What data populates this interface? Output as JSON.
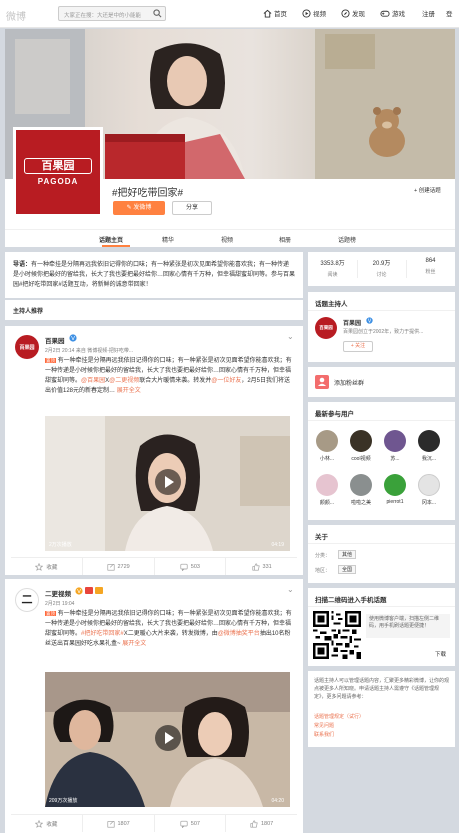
{
  "topbar": {
    "logo": "微博",
    "search_placeholder": "大家正在搜：大还是中的小能能",
    "nav": [
      "首页",
      "视频",
      "发现",
      "游戏"
    ],
    "register": "注册",
    "login": "登"
  },
  "topic": {
    "title": "#把好吃带回家#",
    "brand_cn": "百果园",
    "brand_en": "PAGODA",
    "create_topic": "+ 创建话题",
    "post_button": "发微博",
    "share_button": "分享",
    "tabs": [
      "话题主页",
      "精华",
      "视频",
      "相册",
      "话题榜"
    ]
  },
  "stats": {
    "values": [
      "3353.8万",
      "20.9万",
      "864"
    ],
    "labels": [
      "阅读",
      "讨论",
      "粉丝"
    ]
  },
  "guide": {
    "label": "导语：",
    "text": "有一种牵挂是分隔再远我依旧记得你的口味；有一种紧张是初次见面希望你能喜欢我；有一种传递是小时候你把最好的留给我，长大了我也要把最好给你…回家心情有千万种，但幸福甜蜜却同等。参与百果园#把好吃带回家#话题互动，将新鲜的诚意带回家！"
  },
  "host_recommend": {
    "title": "主持人推荐"
  },
  "posts": [
    {
      "user": "百果园",
      "meta": "2月2日 20:14 来自 微博视频-把好吃带...",
      "text_1": "有一种牵挂是分隔再远我依旧记得你的口味；有一种紧张是初次见面希望你能喜欢我；有一种传递是小时候你把最好的留给我，长大了我也要把最好给你…回家心情有千万种，但幸福甜蜜却同等。",
      "mention_1": "@百果园",
      "text_2": "X",
      "mention_2": "@二更视频",
      "text_3": "联合大片暖情来袭。转发并",
      "mention_3": "@一位好友",
      "text_4": "，2月5日我们将送出价值128元的新春定制…",
      "expand": "展开全文",
      "video_views": "2万次播放",
      "video_time": "04:19",
      "actions": [
        "收藏",
        "2729",
        "503",
        "331"
      ]
    },
    {
      "user": "二更视频",
      "meta": "2月2日 19:04",
      "text_1": "有一种牵挂是分隔再远我依旧记得你的口味；有一种紧张是初次见面希望你能喜欢我；有一种传递是小时候你把最好的留给我，长大了我也要把最好给你…回家心情有千万种，但幸福甜蜜却同等。",
      "topic_tag": "#把好吃带回家#",
      "text_2": "X二更暖心大片来袭，转发微博，由",
      "mention": "@微博抽奖平台",
      "text_3": "抽出10名粉丝送出百果园好吃水果礼盒~",
      "expand": "展开全文",
      "video_views": "209万次播放",
      "video_time": "04:20",
      "actions": [
        "收藏",
        "1807",
        "507",
        "1807"
      ]
    }
  ],
  "host": {
    "title": "话题主持人",
    "name": "百果园",
    "desc": "百果园创立于2002年，致力于提供...",
    "follow": "+ 关注"
  },
  "add_fan": {
    "label": "添加粉丝群"
  },
  "new_users": {
    "title": "最新参与用户",
    "names": [
      "小林...",
      "cool视频",
      "苏...",
      "我沉...",
      "颜颜...",
      "啦啦之美",
      "pierrot1",
      "冈本..."
    ]
  },
  "about": {
    "title": "关于",
    "category_label": "分类：",
    "category_value": "其他",
    "region_label": "地区：",
    "region_value": "全国"
  },
  "qr": {
    "title": "扫描二维码进入手机话题",
    "text": "使用微博客户端，扫描左侧二维码，用手机刷话题更便捷！",
    "download": "下载"
  },
  "rules": {
    "text": "话题主持人可以管理话题内容，汇聚更多精彩微博，让你的观点被更多人所知晓。申请话题主持人需遵守《话题管理规定》，更多问题请参考：",
    "links": [
      "话题管理规定（试行）",
      "常见问题",
      "联系我们"
    ]
  },
  "colors": {
    "accent": "#ff8140",
    "link": "#eb7350",
    "bg": "#d4d9e0",
    "brand_red": "#b81c22"
  }
}
